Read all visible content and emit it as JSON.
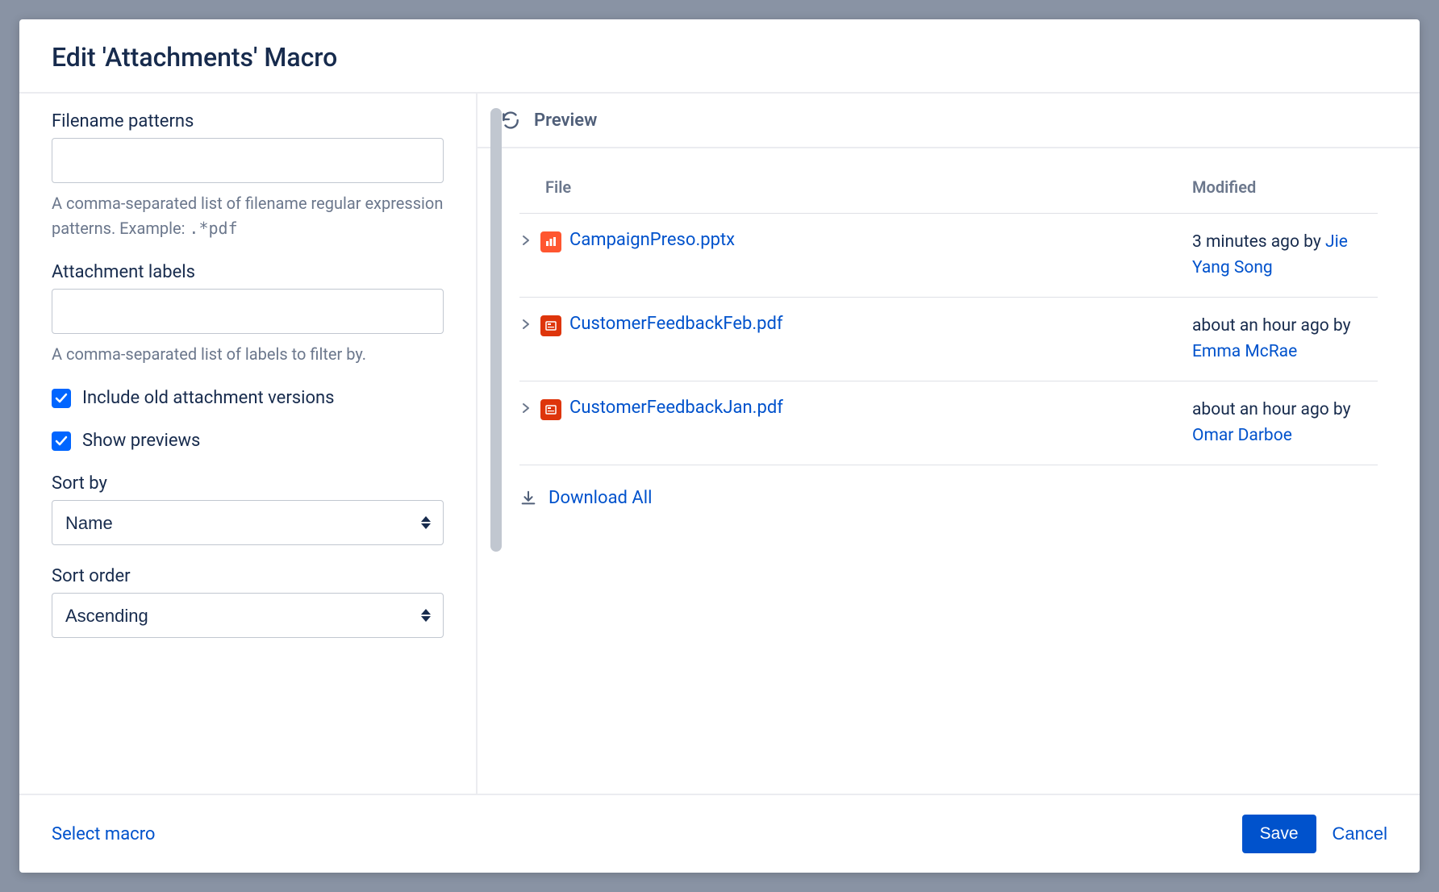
{
  "header": {
    "title": "Edit 'Attachments' Macro"
  },
  "form": {
    "filename_patterns": {
      "label": "Filename patterns",
      "value": "",
      "help": "A comma-separated list of filename regular expression patterns. Example:",
      "example": ".*pdf"
    },
    "attachment_labels": {
      "label": "Attachment labels",
      "value": "",
      "help": "A comma-separated list of labels to filter by."
    },
    "include_old": {
      "label": "Include old attachment versions",
      "checked": true
    },
    "show_previews": {
      "label": "Show previews",
      "checked": true
    },
    "sort_by": {
      "label": "Sort by",
      "value": "Name"
    },
    "sort_order": {
      "label": "Sort order",
      "value": "Ascending"
    }
  },
  "preview": {
    "title": "Preview",
    "columns": {
      "file": "File",
      "modified": "Modified"
    },
    "rows": [
      {
        "name": "CampaignPreso.pptx",
        "icon": "orange",
        "modified_prefix": "3 minutes ago by ",
        "user": "Jie Yang Song"
      },
      {
        "name": "CustomerFeedbackFeb.pdf",
        "icon": "red",
        "modified_prefix": "about an hour ago by ",
        "user": "Emma McRae"
      },
      {
        "name": "CustomerFeedbackJan.pdf",
        "icon": "red",
        "modified_prefix": "about an hour ago by ",
        "user": "Omar Darboe"
      }
    ],
    "download_all": "Download All"
  },
  "footer": {
    "select_macro": "Select macro",
    "save": "Save",
    "cancel": "Cancel"
  }
}
